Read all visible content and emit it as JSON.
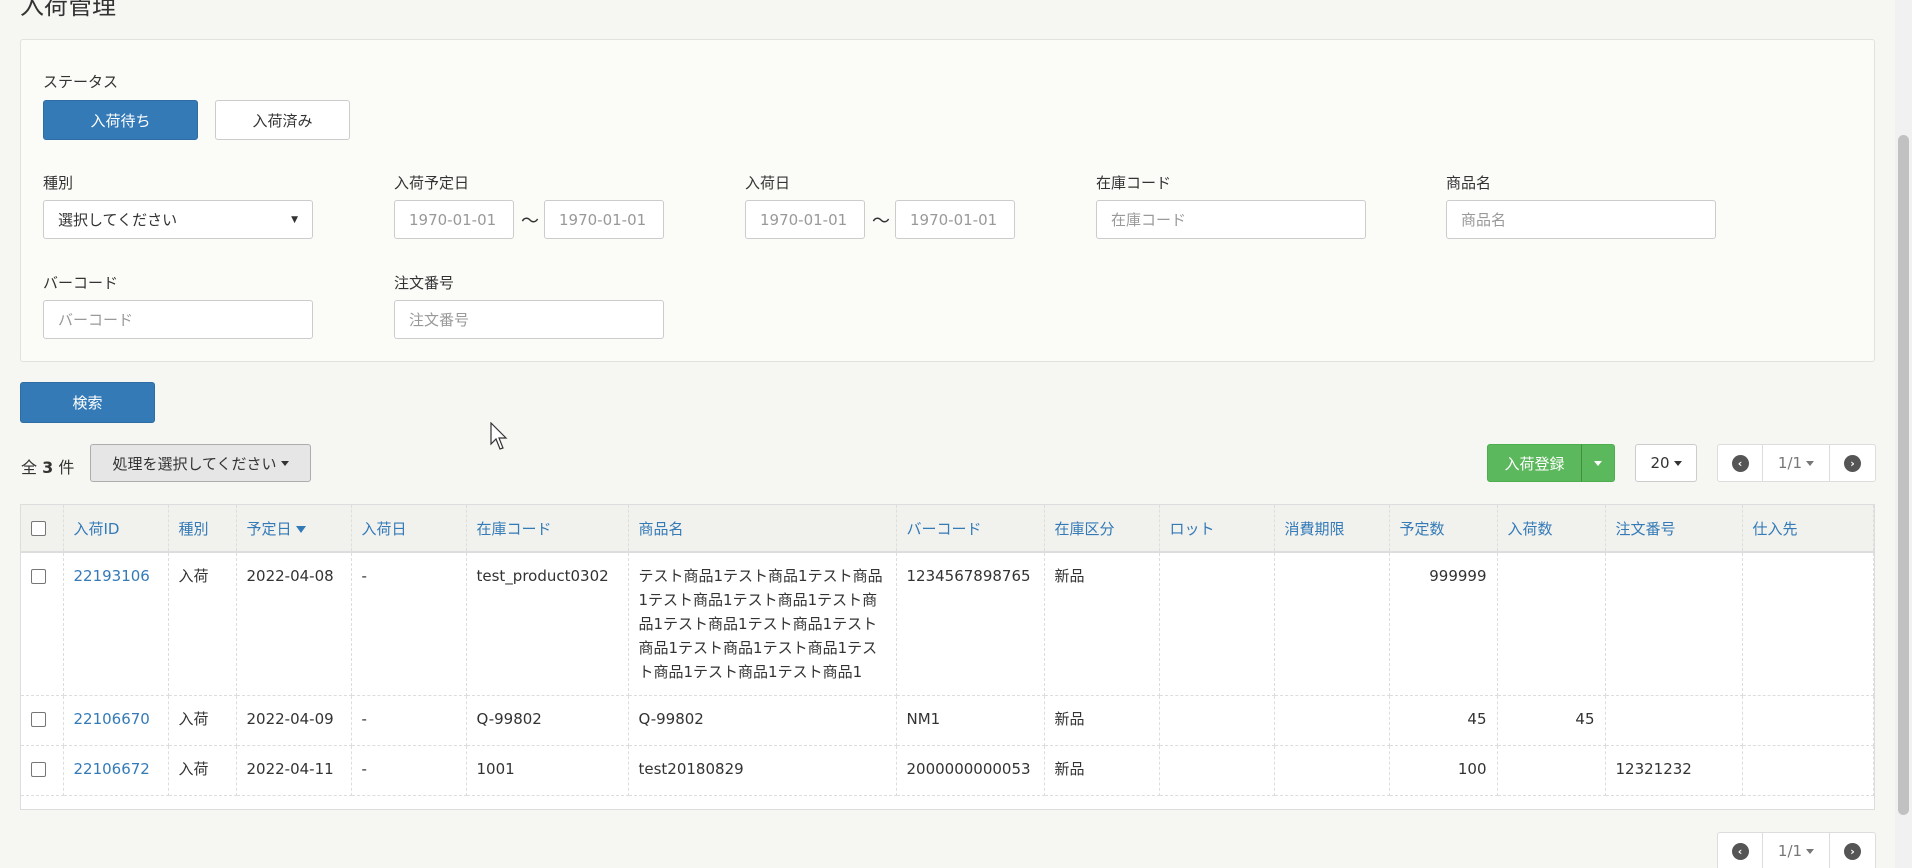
{
  "page": {
    "title": "入荷管理"
  },
  "filters": {
    "status_label": "ステータス",
    "status_options": [
      "入荷待ち",
      "入荷済み"
    ],
    "type_label": "種別",
    "type_value": "選択してください",
    "scheduled_date_label": "入荷予定日",
    "scheduled_from": "1970-01-01",
    "scheduled_to": "1970-01-01",
    "arrival_date_label": "入荷日",
    "arrival_from": "1970-01-01",
    "arrival_to": "1970-01-01",
    "tilde": "〜",
    "stock_code_label": "在庫コード",
    "stock_code_placeholder": "在庫コード",
    "product_name_label": "商品名",
    "product_name_placeholder": "商品名",
    "barcode_label": "バーコード",
    "barcode_placeholder": "バーコード",
    "order_no_label": "注文番号",
    "order_no_placeholder": "注文番号",
    "search_button": "検索"
  },
  "toolbar": {
    "count_prefix": "全",
    "count": "3",
    "count_suffix": "件",
    "bulk_action": "処理を選択してください",
    "register_button": "入荷登録",
    "per_page": "20",
    "page_indicator": "1/1"
  },
  "table": {
    "headers": [
      "入荷ID",
      "種別",
      "予定日",
      "入荷日",
      "在庫コード",
      "商品名",
      "バーコード",
      "在庫区分",
      "ロット",
      "消費期限",
      "予定数",
      "入荷数",
      "注文番号",
      "仕入先"
    ],
    "rows": [
      {
        "id": "22193106",
        "type": "入荷",
        "scheduled": "2022-04-08",
        "arrived": "-",
        "stock_code": "test_product0302",
        "product_name": "テスト商品1テスト商品1テスト商品1テスト商品1テスト商品1テスト商品1テスト商品1テスト商品1テスト商品1テスト商品1テスト商品1テスト商品1テスト商品1テスト商品1",
        "barcode": "1234567898765",
        "category": "新品",
        "lot": "",
        "expiry": "",
        "planned": "999999",
        "received": "",
        "order_no": "",
        "supplier": ""
      },
      {
        "id": "22106670",
        "type": "入荷",
        "scheduled": "2022-04-09",
        "arrived": "-",
        "stock_code": "Q-99802",
        "product_name": "Q-99802",
        "barcode": "NM1",
        "category": "新品",
        "lot": "",
        "expiry": "",
        "planned": "45",
        "received": "45",
        "order_no": "",
        "supplier": ""
      },
      {
        "id": "22106672",
        "type": "入荷",
        "scheduled": "2022-04-11",
        "arrived": "-",
        "stock_code": "1001",
        "product_name": "test20180829",
        "barcode": "2000000000053",
        "category": "新品",
        "lot": "",
        "expiry": "",
        "planned": "100",
        "received": "",
        "order_no": "12321232",
        "supplier": ""
      }
    ]
  },
  "colors": {
    "primary": "#337ab7",
    "success": "#5cb85c"
  }
}
